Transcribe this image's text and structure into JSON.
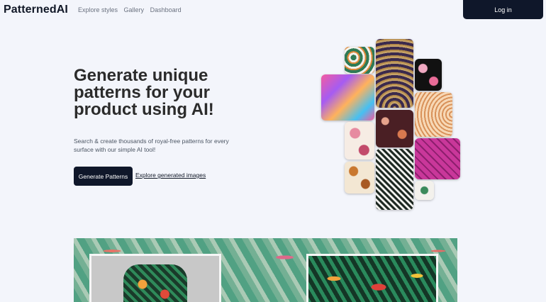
{
  "nav": {
    "logo": "PatternedAI",
    "links": [
      "Explore styles",
      "Gallery",
      "Dashboard"
    ],
    "login_label": "Log in"
  },
  "hero": {
    "title": "Generate unique patterns for your product using AI!",
    "subtitle": "Search & create thousands of royal-free patterns for every surface with our simple AI tool!",
    "primary_button": "Generate Patterns",
    "secondary_link": "Explore generated images"
  },
  "colors": {
    "background": "#f3f5fb",
    "primary_dark": "#0f172a"
  }
}
